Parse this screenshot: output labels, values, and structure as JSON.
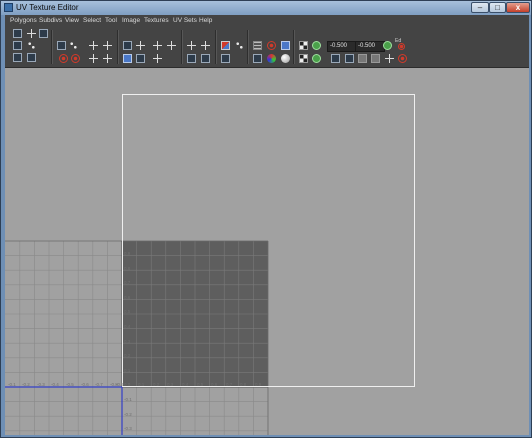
{
  "window": {
    "title": "UV Texture Editor",
    "buttons": {
      "minimize": "–",
      "maximize": "□",
      "close": "x"
    }
  },
  "menu": [
    "Polygons",
    "Subdivs",
    "View",
    "Select",
    "Tool",
    "Image",
    "Textures",
    "UV Sets",
    "Help"
  ],
  "toolbar": {
    "u_value": "-0.500",
    "v_value": "-0.500",
    "ed_label": "Ed"
  },
  "axis": {
    "bottom_labels": [
      "-0.1",
      "-0.2",
      "-0.3",
      "-0.4",
      "-0.5",
      "-0.6",
      "-0.7",
      "-0.8",
      "-0.9",
      "0.0",
      "0.1",
      "0.2",
      "0.3",
      "0.4",
      "0.5",
      "0.6",
      "0.7",
      "0.8",
      "0.9"
    ],
    "left_labels": [
      "0.9",
      "0.8",
      "0.7",
      "0.6",
      "0.5",
      "0.4",
      "0.3",
      "0.2",
      "0.1"
    ],
    "below_labels": [
      "-0.1",
      "-0.2",
      "-0.3"
    ]
  },
  "colors": {
    "viewport_bg": "#a1a1a1",
    "dark_tile": "#5e5e5e",
    "grid_line": "#8a8a8a",
    "dark_grid_line": "#7a7a7a",
    "uv_border": "#efefef",
    "u_axis": "#3340c8",
    "v_axis": "#4a4a4a"
  }
}
